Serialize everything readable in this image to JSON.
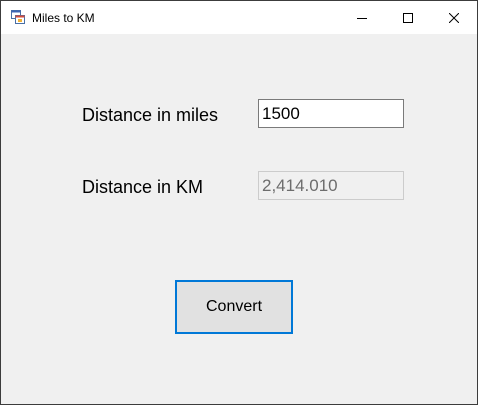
{
  "window": {
    "title": "Miles to KM",
    "controls": {
      "minimize": "minimize-icon",
      "maximize": "maximize-icon",
      "close": "close-icon"
    }
  },
  "form": {
    "miles_label": "Distance in miles",
    "miles_value": "1500",
    "km_label": "Distance in KM",
    "km_value": "2,414.010",
    "convert_label": "Convert"
  },
  "colors": {
    "accent": "#0078d7",
    "window_bg": "#f0f0f0",
    "titlebar_bg": "#ffffff"
  }
}
